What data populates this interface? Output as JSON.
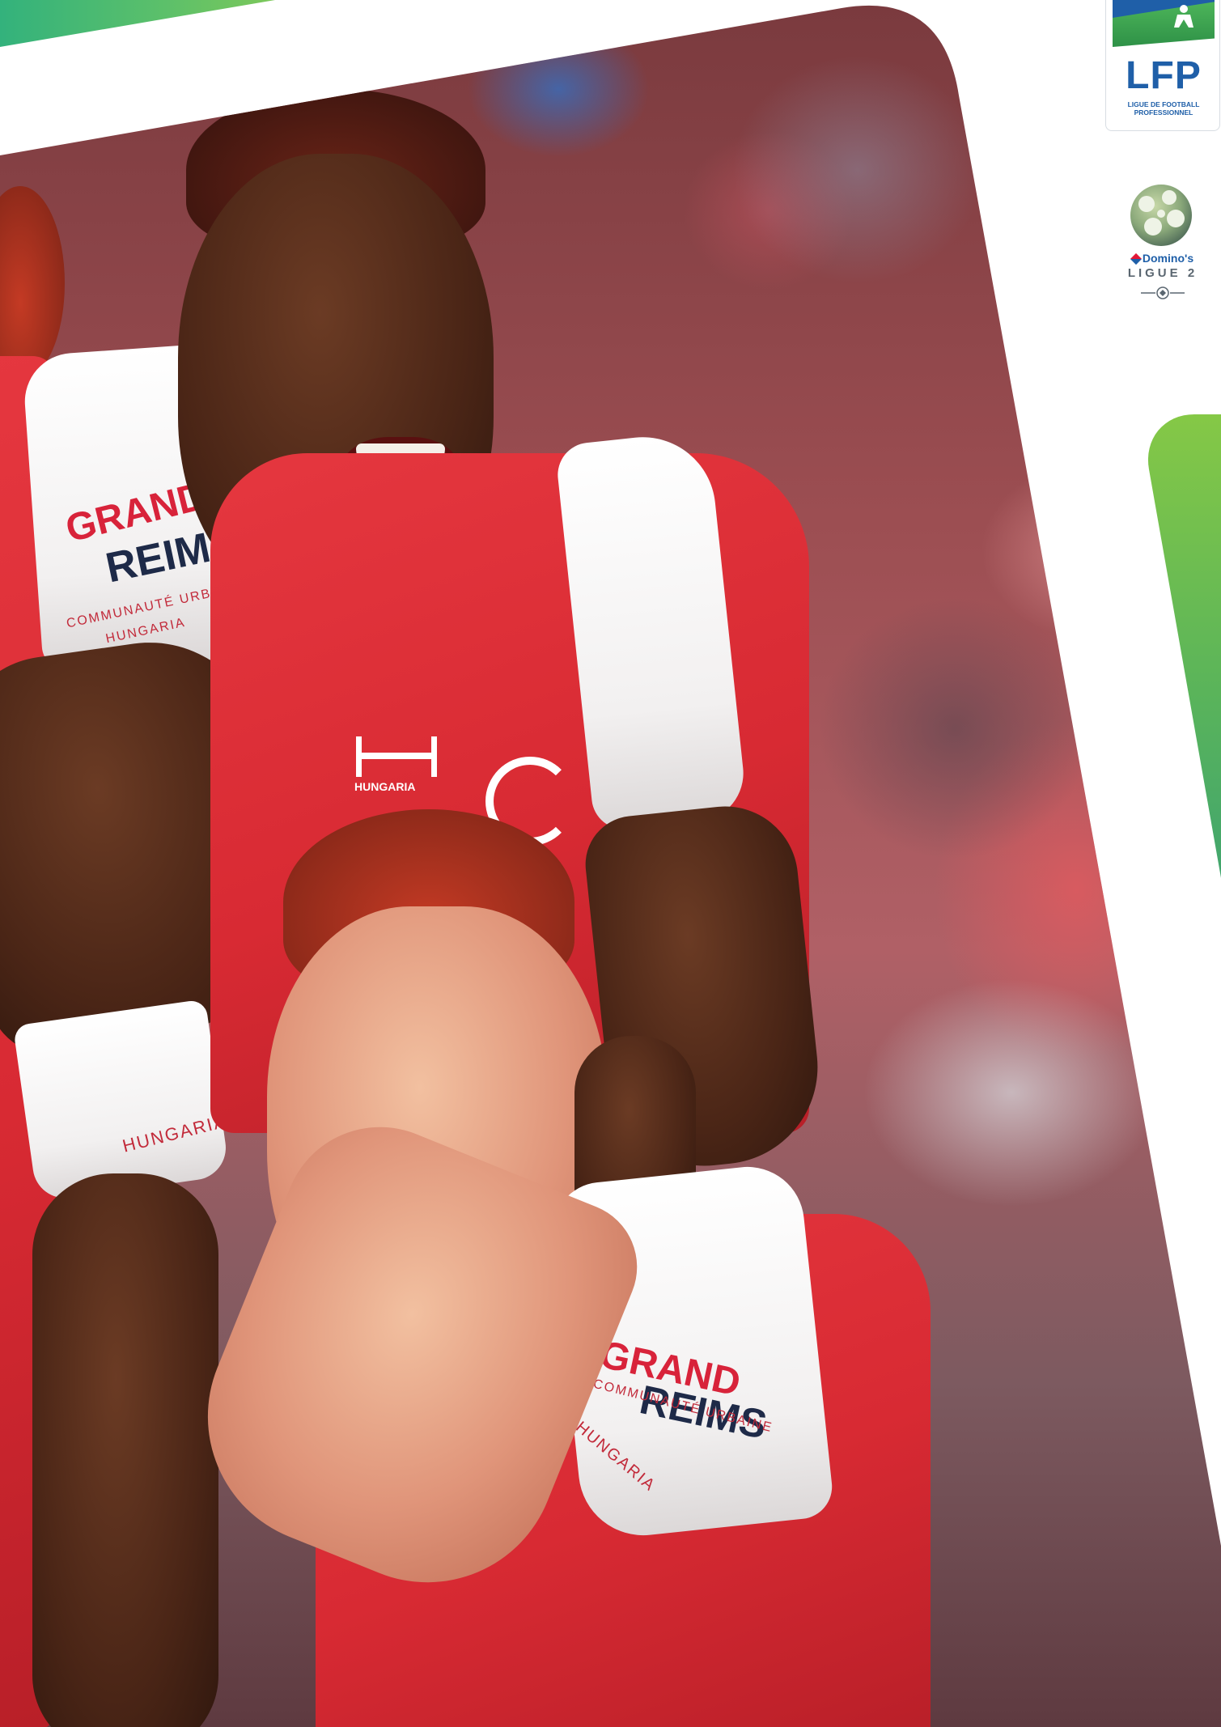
{
  "logos": {
    "lfp": {
      "name": "LFP",
      "subtitle": "LIGUE DE FOOTBALL PROFESSIONNEL"
    },
    "ligue2": {
      "sponsor": "Domino's",
      "name": "LIGUE 2"
    }
  },
  "photo_text": {
    "sleeve_top_grand": "GRAND",
    "sleeve_top_reims": "REIMS",
    "sleeve_top_communaute": "COMMUNAUTÉ URBAINE",
    "sleeve_top_hungaria": "HUNGARIA",
    "cuff_hungaria": "HUNGARIA",
    "chest_hummel": "HUNGARIA",
    "sleeve_bottom_grand": "GRAND",
    "sleeve_bottom_reims": "REIMS",
    "sleeve_bottom_communaute": "COMMUNAUTÉ URBAINE",
    "sleeve_bottom_hungaria": "HUNGARIA"
  },
  "colors": {
    "brand_green_light": "#85c846",
    "brand_green_dark": "#2e9a7e",
    "lfp_blue": "#1f5fa8",
    "jersey_red": "#d82a33"
  }
}
